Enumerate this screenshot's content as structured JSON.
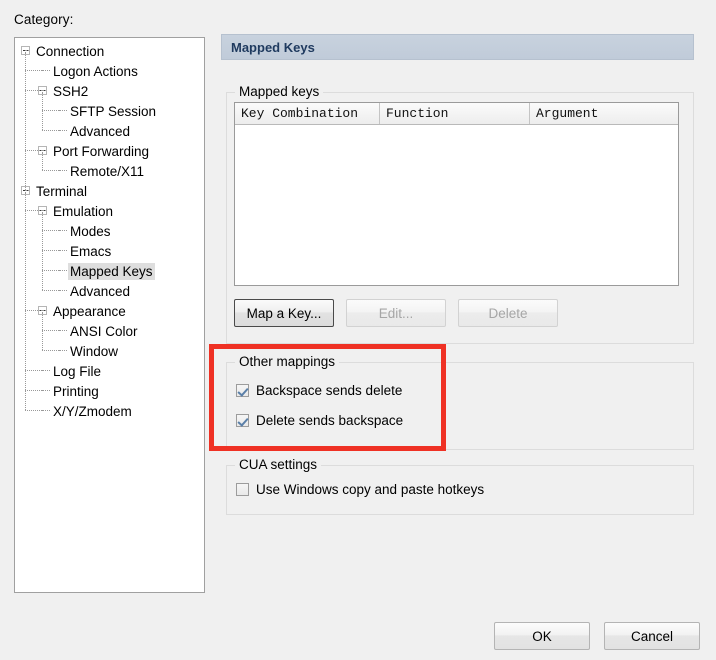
{
  "dialog": {
    "category_label": "Category:",
    "background_color": "#f0f0f0"
  },
  "tree": {
    "selected": "Mapped Keys",
    "items": [
      {
        "label": "Connection",
        "level": 0,
        "expander": true
      },
      {
        "label": "Logon Actions",
        "level": 1,
        "expander": false
      },
      {
        "label": "SSH2",
        "level": 1,
        "expander": true
      },
      {
        "label": "SFTP Session",
        "level": 2,
        "expander": false
      },
      {
        "label": "Advanced",
        "level": 2,
        "expander": false
      },
      {
        "label": "Port Forwarding",
        "level": 1,
        "expander": true
      },
      {
        "label": "Remote/X11",
        "level": 2,
        "expander": false
      },
      {
        "label": "Terminal",
        "level": 0,
        "expander": true
      },
      {
        "label": "Emulation",
        "level": 1,
        "expander": true
      },
      {
        "label": "Modes",
        "level": 2,
        "expander": false
      },
      {
        "label": "Emacs",
        "level": 2,
        "expander": false
      },
      {
        "label": "Mapped Keys",
        "level": 2,
        "expander": false
      },
      {
        "label": "Advanced",
        "level": 2,
        "expander": false
      },
      {
        "label": "Appearance",
        "level": 1,
        "expander": true
      },
      {
        "label": "ANSI Color",
        "level": 2,
        "expander": false
      },
      {
        "label": "Window",
        "level": 2,
        "expander": false
      },
      {
        "label": "Log File",
        "level": 1,
        "expander": false
      },
      {
        "label": "Printing",
        "level": 1,
        "expander": false
      },
      {
        "label": "X/Y/Zmodem",
        "level": 1,
        "expander": false
      }
    ]
  },
  "pane": {
    "header_title": "Mapped Keys",
    "header_color": "#c3cedc"
  },
  "mapped_keys_group": {
    "title": "Mapped keys",
    "table": {
      "columns": [
        "Key Combination",
        "Function",
        "Argument"
      ],
      "rows": []
    },
    "buttons": {
      "map_a_key": "Map a Key...",
      "edit": "Edit...",
      "delete": "Delete"
    }
  },
  "other_mappings_group": {
    "title": "Other mappings",
    "checkboxes": [
      {
        "label": "Backspace sends delete",
        "checked": true
      },
      {
        "label": "Delete sends backspace",
        "checked": true
      }
    ]
  },
  "cua_settings_group": {
    "title": "CUA settings",
    "checkboxes": [
      {
        "label": "Use Windows copy and paste hotkeys",
        "checked": false
      }
    ]
  },
  "dialog_buttons": {
    "ok": "OK",
    "cancel": "Cancel"
  },
  "annotation": {
    "color": "#ef3124",
    "target": "Other mappings"
  }
}
